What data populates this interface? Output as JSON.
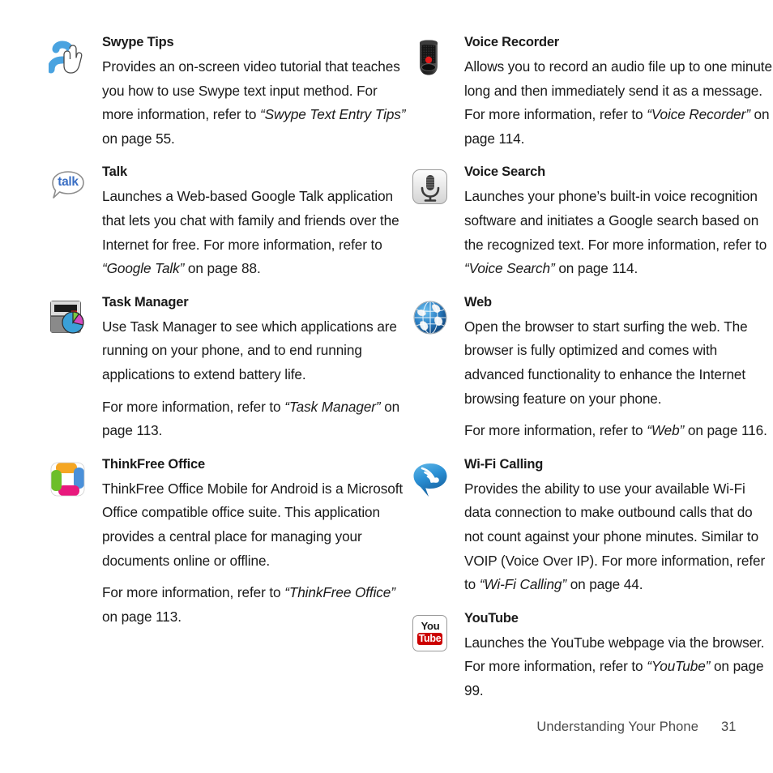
{
  "document": {
    "footer": {
      "chapter": "Understanding Your Phone",
      "page_number": "31"
    }
  },
  "left_column": {
    "entries": [
      {
        "icon": "swype-tips-icon",
        "title": "Swype Tips",
        "paragraphs": [
          {
            "segments": [
              {
                "text": "Provides an on-screen video tutorial that teaches you how to use Swype text input method. For more information, refer to ",
                "style": "normal"
              },
              {
                "text": "“Swype Text Entry Tips”",
                "style": "italic"
              },
              {
                "text": "  on page 55.",
                "style": "normal"
              }
            ]
          }
        ]
      },
      {
        "icon": "google-talk-icon",
        "title": "Talk",
        "paragraphs": [
          {
            "segments": [
              {
                "text": "Launches a Web-based Google Talk application that lets you chat with family and friends over the Internet for free. For more information, refer to ",
                "style": "normal"
              },
              {
                "text": "“Google Talk”",
                "style": "italic"
              },
              {
                "text": "  on page 88.",
                "style": "normal"
              }
            ]
          }
        ]
      },
      {
        "icon": "task-manager-icon",
        "title": "Task Manager",
        "paragraphs": [
          {
            "segments": [
              {
                "text": "Use Task Manager to see which applications are running on your phone, and to end running applications to extend battery life.",
                "style": "normal"
              }
            ]
          },
          {
            "segments": [
              {
                "text": "For more information, refer to ",
                "style": "normal"
              },
              {
                "text": "“Task Manager”",
                "style": "italic"
              },
              {
                "text": "  on page 113.",
                "style": "normal"
              }
            ]
          }
        ]
      },
      {
        "icon": "thinkfree-office-icon",
        "title": "ThinkFree Office",
        "paragraphs": [
          {
            "segments": [
              {
                "text": "ThinkFree Office Mobile for Android is a Microsoft Office compatible office suite. This application provides a central place for managing your documents online or offline.",
                "style": "normal"
              }
            ]
          },
          {
            "segments": [
              {
                "text": "For more information, refer to ",
                "style": "normal"
              },
              {
                "text": "“ThinkFree Office”",
                "style": "italic"
              },
              {
                "text": "  on page 113.",
                "style": "normal"
              }
            ]
          }
        ]
      }
    ]
  },
  "right_column": {
    "entries": [
      {
        "icon": "voice-recorder-icon",
        "title": "Voice Recorder",
        "paragraphs": [
          {
            "segments": [
              {
                "text": "Allows you to record an audio file up to one minute long and then immediately send it as a message. For more information, refer to ",
                "style": "normal"
              },
              {
                "text": "“Voice Recorder”",
                "style": "italic"
              },
              {
                "text": "  on page 114.",
                "style": "normal"
              }
            ]
          }
        ]
      },
      {
        "icon": "voice-search-icon",
        "title": "Voice Search",
        "paragraphs": [
          {
            "segments": [
              {
                "text": "Launches your phone’s built-in voice recognition software and initiates a Google search based on the recognized text. For more information, refer to ",
                "style": "normal"
              },
              {
                "text": "“Voice Search”",
                "style": "italic"
              },
              {
                "text": " on page 114.",
                "style": "normal"
              }
            ]
          }
        ]
      },
      {
        "icon": "web-globe-icon",
        "title": "Web",
        "paragraphs": [
          {
            "segments": [
              {
                "text": "Open the browser to start surfing the web. The browser is fully optimized and comes with advanced functionality to enhance the Internet browsing feature on your phone.",
                "style": "normal"
              }
            ]
          },
          {
            "segments": [
              {
                "text": "For more information, refer to ",
                "style": "normal"
              },
              {
                "text": "“Web”",
                "style": "italic"
              },
              {
                "text": "  on page 116.",
                "style": "normal"
              }
            ]
          }
        ]
      },
      {
        "icon": "wifi-calling-icon",
        "title": "Wi-Fi Calling",
        "paragraphs": [
          {
            "segments": [
              {
                "text": "Provides the ability to use your available Wi-Fi data connection to make outbound calls that do not count against your phone minutes. Similar to VOIP (Voice Over IP). For more information, refer to ",
                "style": "normal"
              },
              {
                "text": "“Wi-Fi Calling”",
                "style": "italic"
              },
              {
                "text": " on page 44.",
                "style": "normal"
              }
            ]
          }
        ]
      },
      {
        "icon": "youtube-icon",
        "title": "YouTube",
        "paragraphs": [
          {
            "segments": [
              {
                "text": "Launches the YouTube webpage via the browser.  For more information, refer to ",
                "style": "normal"
              },
              {
                "text": "“YouTube”",
                "style": "italic"
              },
              {
                "text": "  on page 99.",
                "style": "normal"
              }
            ]
          }
        ]
      }
    ]
  },
  "icon_labels": {
    "google-talk-icon": "talk",
    "youtube-icon": {
      "top": "You",
      "bottom": "Tube"
    }
  },
  "colors": {
    "swype_blue": "#4aa3e0",
    "talk_blue": "#3b6fc4",
    "youtube_red": "#cc0000",
    "thinkfree_orange": "#f5a623",
    "thinkfree_blue": "#4a90d9",
    "thinkfree_pink": "#e8197d",
    "thinkfree_green": "#6cbe2a",
    "web_blue": "#1f6fb5",
    "wifi_blue": "#2a8fd4",
    "record_red": "#e01b1b",
    "text": "#1a1a1a",
    "footer_text": "#4a4a4a"
  }
}
